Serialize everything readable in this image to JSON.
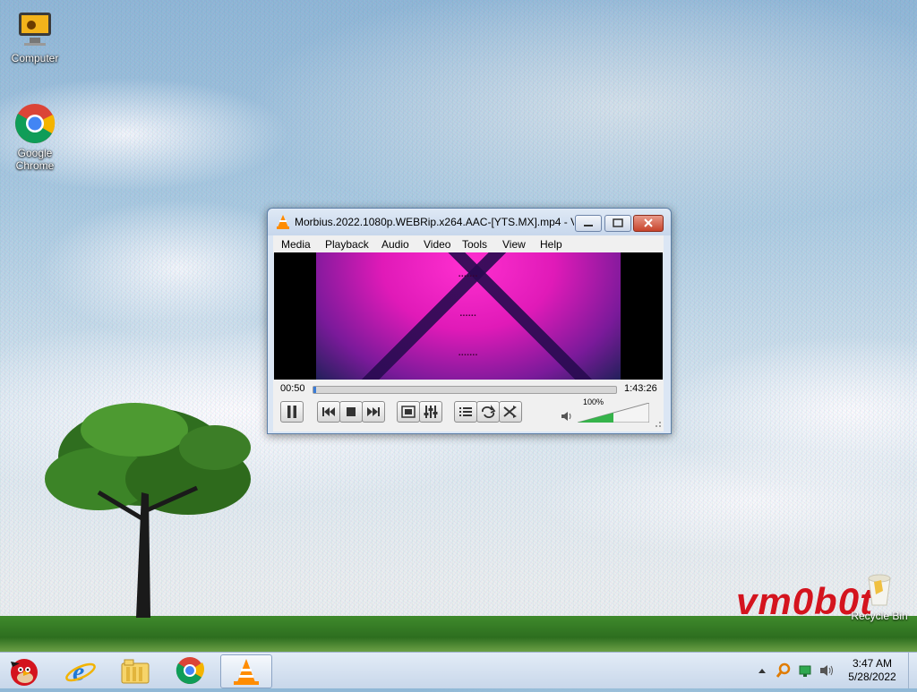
{
  "desktop": {
    "icons": [
      {
        "label": "Computer",
        "icon": "computer-icon"
      },
      {
        "label": "Google\nChrome",
        "icon": "chrome-icon"
      }
    ],
    "watermark": "vm0b0t",
    "recycle_bin_label": "Recycle Bin"
  },
  "vlc": {
    "title": "Morbius.2022.1080p.WEBRip.x264.AAC-[YTS.MX].mp4 - V...",
    "menu": [
      "Media",
      "Playback",
      "Audio",
      "Video",
      "Tools",
      "View",
      "Help"
    ],
    "elapsed": "00:50",
    "duration": "1:43:26",
    "progress_fraction": 0.008,
    "volume_label": "100%",
    "volume_fraction": 1.0,
    "buttons": [
      "pause",
      "previous",
      "stop",
      "next",
      "fullscreen",
      "extended-settings",
      "playlist",
      "loop",
      "shuffle"
    ]
  },
  "taskbar": {
    "apps": [
      "angry-birds-icon",
      "internet-explorer-icon",
      "file-explorer-icon",
      "chrome-icon",
      "vlc-icon"
    ],
    "active_app": "vlc-icon",
    "clock": {
      "time": "3:47 AM",
      "date": "5/28/2022"
    }
  },
  "colors": {
    "vlc_orange": "#ff8c00",
    "close_red": "#c8442c",
    "accent": "#3a7bd5"
  }
}
